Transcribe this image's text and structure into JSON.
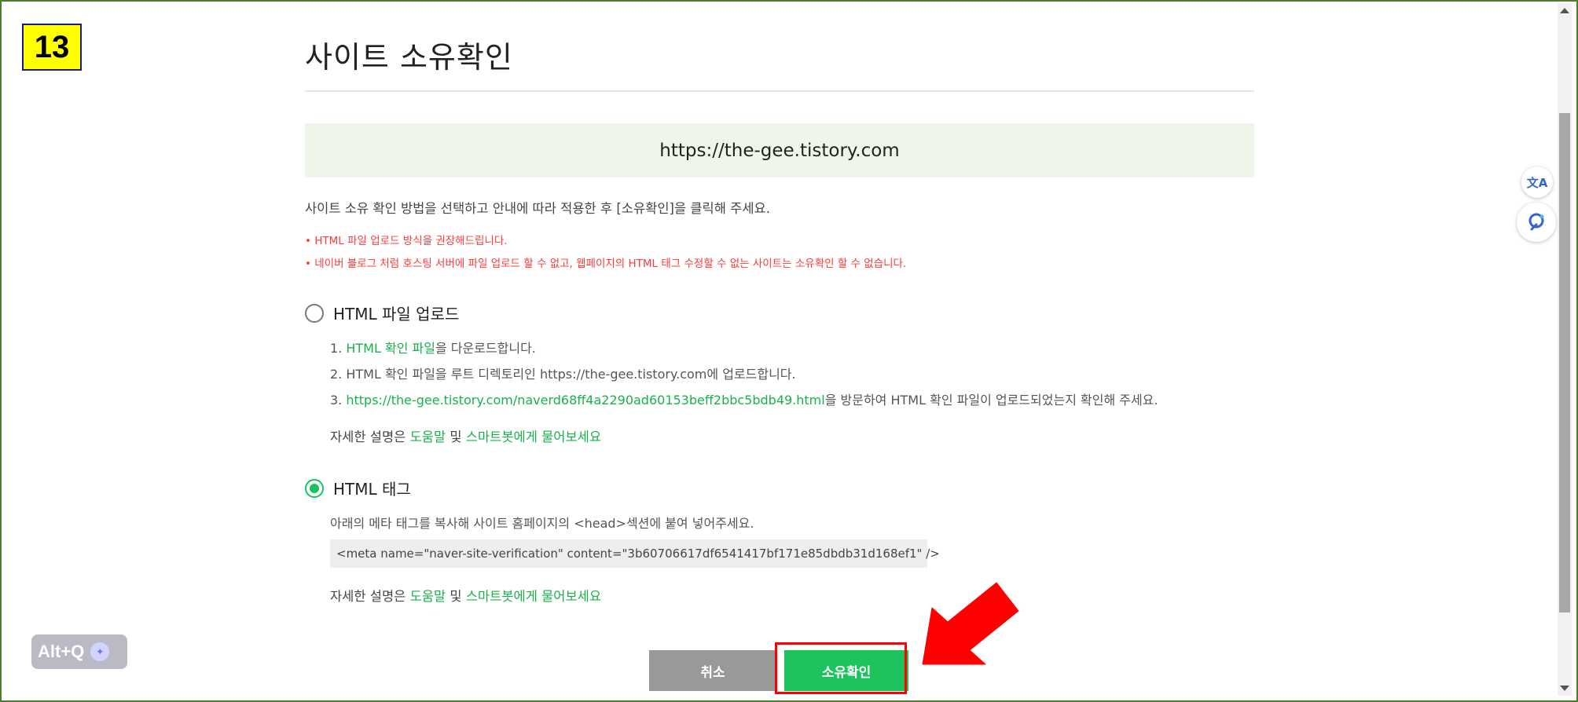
{
  "step_badge": "13",
  "page": {
    "title": "사이트 소유확인",
    "site_url": "https://the-gee.tistory.com",
    "guide_text": "사이트 소유 확인 방법을 선택하고 안내에 따라 적용한 후 [소유확인]을 클릭해 주세요.",
    "notes": [
      "• HTML 파일 업로드 방식을 권장해드립니다.",
      "• 네이버 블로그 처럼 호스팅 서버에 파일 업로드 할 수 없고, 웹페이지의 HTML 태그 수정할 수 없는 사이트는 소유확인 할 수 없습니다."
    ]
  },
  "method_file": {
    "label": "HTML 파일 업로드",
    "selected": false,
    "step1_prefix": "1. ",
    "step1_link": "HTML 확인 파일",
    "step1_suffix": "을 다운로드합니다.",
    "step2": "2. HTML 확인 파일을 루트 디렉토리인 https://the-gee.tistory.com에 업로드합니다.",
    "step3_prefix": "3. ",
    "step3_link": "https://the-gee.tistory.com/naverd68ff4a2290ad60153beff2bbc5bdb49.html",
    "step3_suffix": "을 방문하여 HTML 확인 파일이 업로드되었는지 확인해 주세요.",
    "help_prefix": "자세한 설명은 ",
    "help_link1": "도움말",
    "help_mid": " 및 ",
    "help_link2": "스마트봇에게 물어보세요"
  },
  "method_tag": {
    "label": "HTML 태그",
    "selected": true,
    "desc": "아래의 메타 태그를 복사해 사이트 홈페이지의 <head>섹션에 붙여 넣어주세요.",
    "meta_code": "<meta name=\"naver-site-verification\" content=\"3b60706617df6541417bf171e85dbdb31d168ef1\" />",
    "help_prefix": "자세한 설명은 ",
    "help_link1": "도움말",
    "help_mid": " 및 ",
    "help_link2": "스마트봇에게 물어보세요"
  },
  "buttons": {
    "cancel": "취소",
    "confirm": "소유확인"
  },
  "altq": {
    "label": "Alt+Q"
  },
  "side_tools": {
    "translate_icon": "translate-icon",
    "assistant_icon": "assistant-icon"
  },
  "colors": {
    "accent_green": "#19c35b",
    "notice_red": "#ff3b3b",
    "url_box_bg": "#eff6e9",
    "annotation_red": "#ff0000",
    "badge_yellow": "#ffff00"
  }
}
